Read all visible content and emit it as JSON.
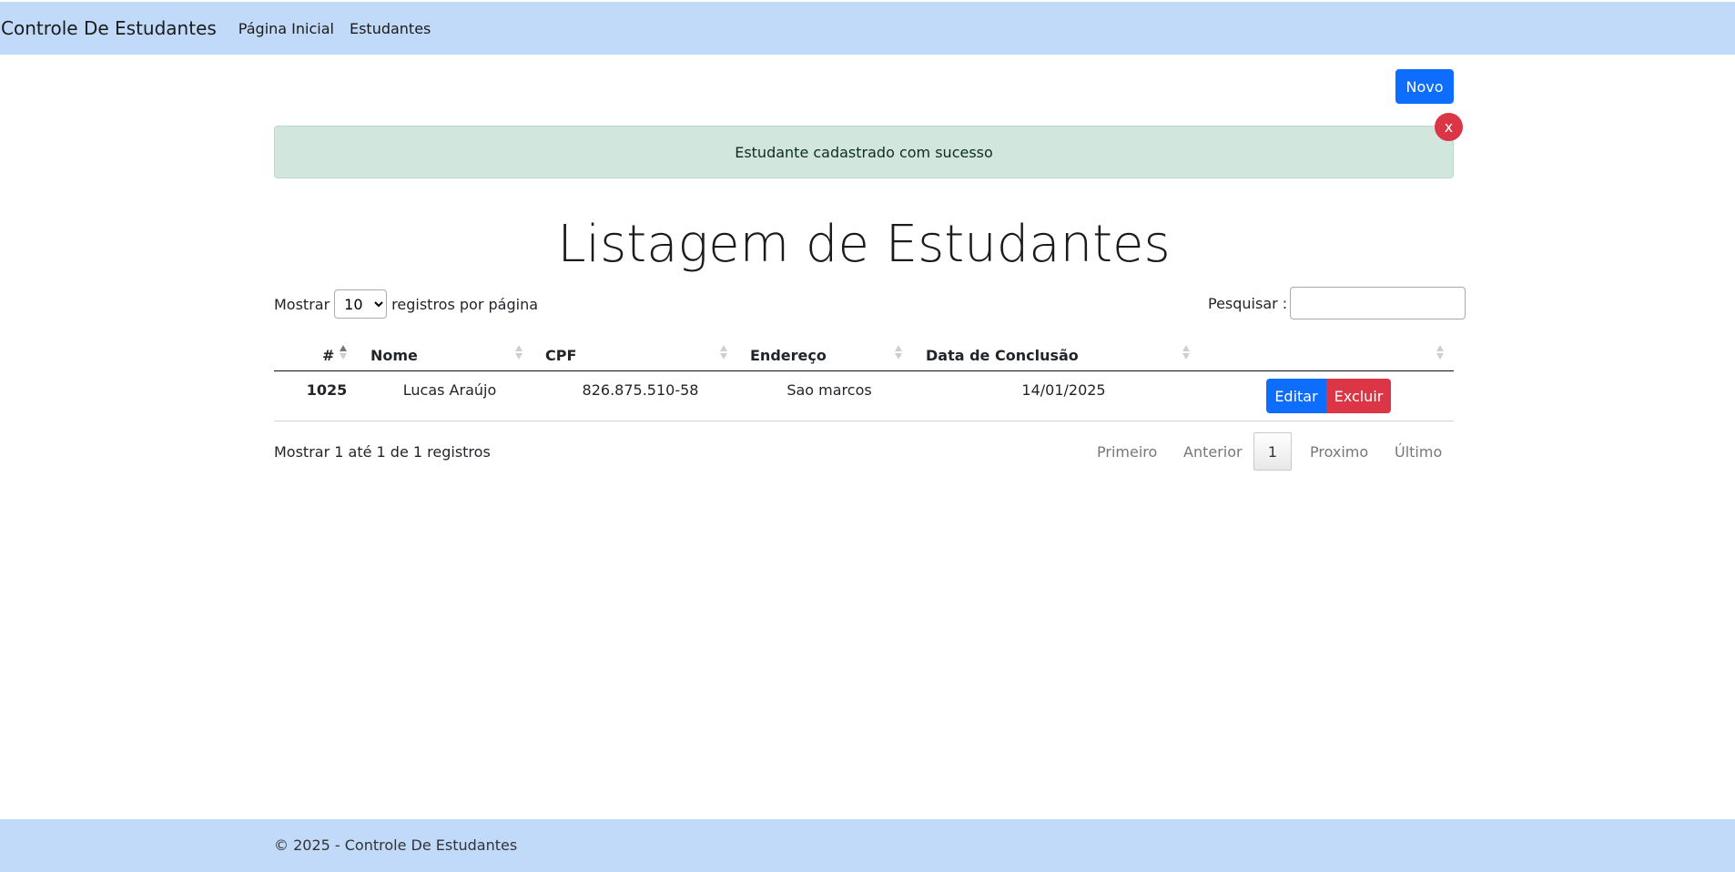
{
  "navbar": {
    "brand": "Controle De Estudantes",
    "links": [
      "Página Inicial",
      "Estudantes"
    ]
  },
  "actions": {
    "new_label": "Novo"
  },
  "alert": {
    "message": "Estudante cadastrado com sucesso",
    "close_label": "x"
  },
  "page_title": "Listagem de Estudantes",
  "length_menu": {
    "prefix": "Mostrar",
    "value": "10",
    "suffix": "registros por página"
  },
  "search": {
    "label": "Pesquisar :",
    "value": ""
  },
  "table": {
    "headers": [
      "#",
      "Nome",
      "CPF",
      "Endereço",
      "Data de Conclusão",
      ""
    ],
    "rows": [
      {
        "id": "1025",
        "name": "Lucas Araújo",
        "cpf": "826.875.510-58",
        "address": "Sao marcos",
        "completion_date": "14/01/2025",
        "edit_label": "Editar",
        "delete_label": "Excluir"
      }
    ]
  },
  "info": "Mostrar 1 até 1 de 1 registros",
  "pagination": {
    "first": "Primeiro",
    "previous": "Anterior",
    "current": "1",
    "next": "Proximo",
    "last": "Último"
  },
  "footer": {
    "text": "© 2025 - Controle De Estudantes"
  },
  "colors": {
    "navbar_bg": "#c2daf9",
    "primary": "#0d6efd",
    "danger": "#dc3545",
    "success_bg": "#d1e7dd"
  }
}
